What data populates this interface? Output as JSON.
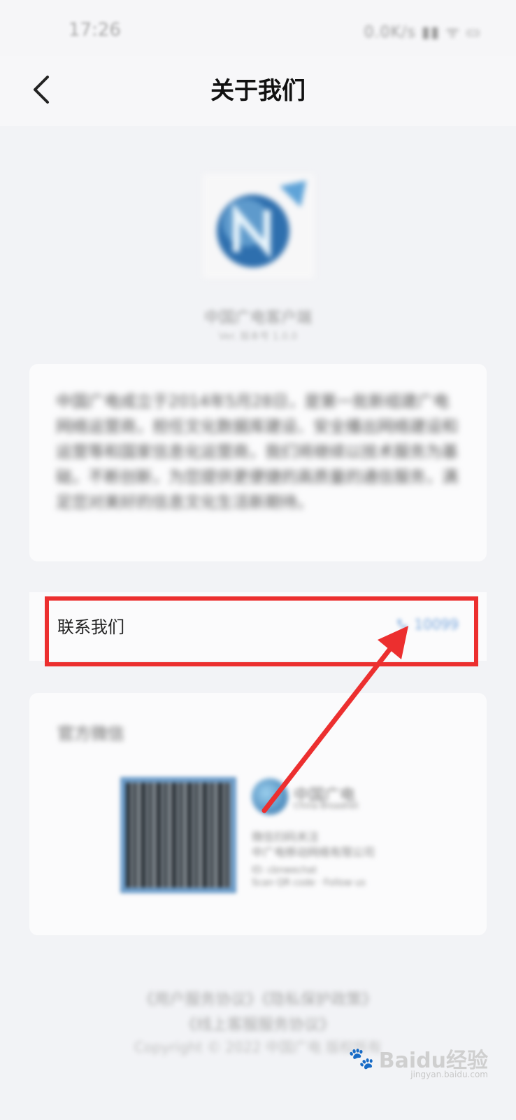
{
  "status_bar": {
    "time": "17:26",
    "icons_text": "0.0K/s ▮▮ ᯤ ▭"
  },
  "header": {
    "title": "关于我们",
    "back_icon": "chevron-left-icon"
  },
  "app": {
    "name": "中国广电客户端",
    "version": "Ver. 版本号 1.0.0"
  },
  "description": {
    "text": "中国广电成立于2014年5月28日，是第一批新组建广电网络运营商，担任文化数据库建设、安全播出网络建设和运营等和国家信息化运营商，我们将继续以技术服务为基础，不断创新，为您提供更便捷的高质量的通信服务，满足您对美好的信息文化生活新期待。"
  },
  "contact": {
    "label": "联系我们",
    "action_text": "10099",
    "action_icon": "phone-icon"
  },
  "qr_section": {
    "title": "官方微信",
    "brand": "中国广电",
    "brand_sub": "China Broadnet",
    "lines": [
      "微信扫码关注",
      "中广电移动网络有限公司",
      "ID: cbnwechat",
      "Scan QR code · Follow us"
    ]
  },
  "footer": {
    "links": "《用户服务协议》《隐私保护政策》",
    "links2": "《线上客服服务协议》",
    "copyright": "Copyright © 2022 中国广电 版权所有"
  },
  "watermark": {
    "text": "Baidu经验",
    "sub": "jingyan.baidu.com"
  },
  "colors": {
    "highlight": "#ec2f2f",
    "accent": "#79a7dc",
    "background": "#f2f3f6"
  }
}
